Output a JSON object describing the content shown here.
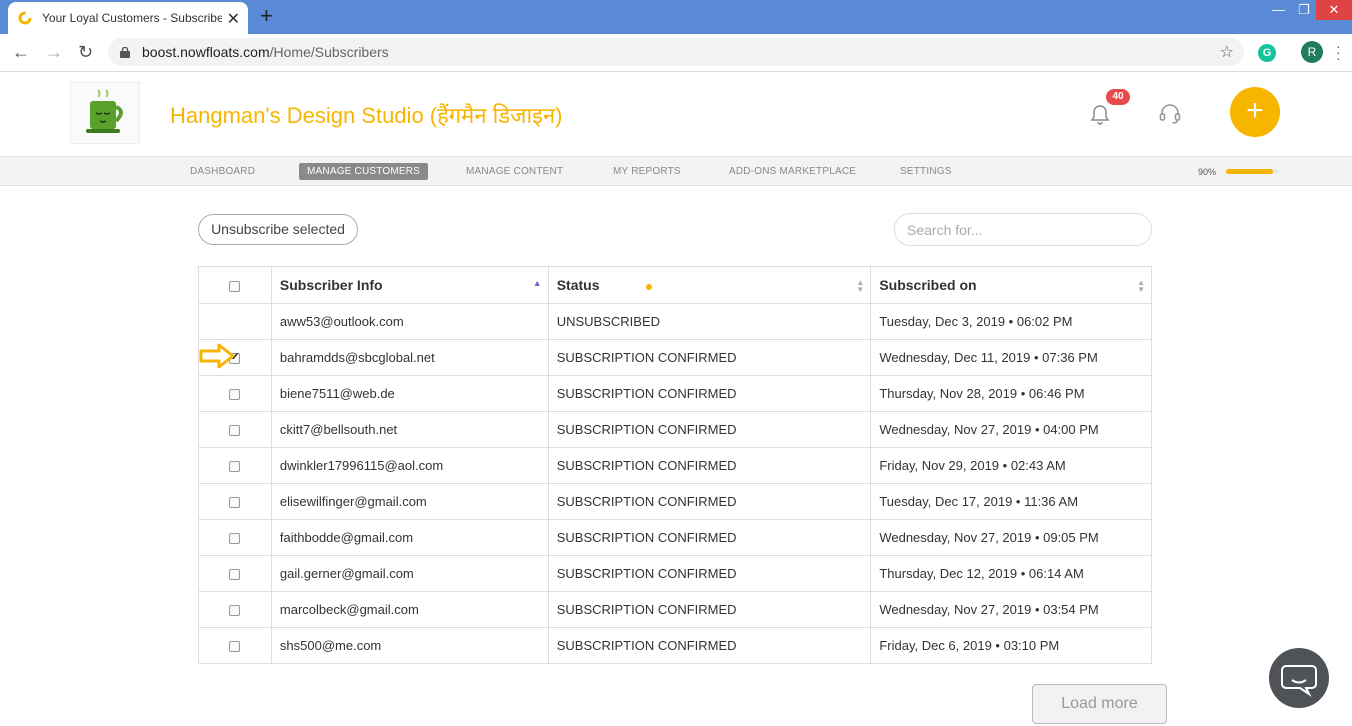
{
  "browser": {
    "tab_title": "Your Loyal Customers - Subscribers",
    "url_host": "boost.nowfloats.com",
    "url_path": "/Home/Subscribers",
    "profile_initial": "R",
    "extension_initial": "G"
  },
  "header": {
    "brand": "Hangman's Design Studio (हैंगमैन डिजाइन)",
    "notification_count": "40",
    "add_label": "+"
  },
  "nav": {
    "items": [
      "DASHBOARD",
      "MANAGE CUSTOMERS",
      "MANAGE CONTENT",
      "MY REPORTS",
      "ADD-ONS MARKETPLACE",
      "SETTINGS"
    ],
    "active": "MANAGE CUSTOMERS",
    "progress_label": "90%",
    "progress_value": 90
  },
  "toolbar": {
    "unsubscribe_label": "Unsubscribe selected",
    "search_placeholder": "Search for..."
  },
  "table": {
    "headers": [
      "Subscriber Info",
      "Status",
      "Subscribed on"
    ],
    "rows": [
      {
        "email": "aww53@outlook.com",
        "status": "UNSUBSCRIBED",
        "date": "Tuesday, Dec 3, 2019 • 06:02 PM",
        "checkbox": false,
        "checked": false
      },
      {
        "email": "bahramdds@sbcglobal.net",
        "status": "SUBSCRIPTION CONFIRMED",
        "date": "Wednesday, Dec 11, 2019 • 07:36 PM",
        "checkbox": true,
        "checked": true
      },
      {
        "email": "biene7511@web.de",
        "status": "SUBSCRIPTION CONFIRMED",
        "date": "Thursday, Nov 28, 2019 • 06:46 PM",
        "checkbox": true,
        "checked": false
      },
      {
        "email": "ckitt7@bellsouth.net",
        "status": "SUBSCRIPTION CONFIRMED",
        "date": "Wednesday, Nov 27, 2019 • 04:00 PM",
        "checkbox": true,
        "checked": false
      },
      {
        "email": "dwinkler17996115@aol.com",
        "status": "SUBSCRIPTION CONFIRMED",
        "date": "Friday, Nov 29, 2019 • 02:43 AM",
        "checkbox": true,
        "checked": false
      },
      {
        "email": "elisewilfinger@gmail.com",
        "status": "SUBSCRIPTION CONFIRMED",
        "date": "Tuesday, Dec 17, 2019 • 11:36 AM",
        "checkbox": true,
        "checked": false
      },
      {
        "email": "faithbodde@gmail.com",
        "status": "SUBSCRIPTION CONFIRMED",
        "date": "Wednesday, Nov 27, 2019 • 09:05 PM",
        "checkbox": true,
        "checked": false
      },
      {
        "email": "gail.gerner@gmail.com",
        "status": "SUBSCRIPTION CONFIRMED",
        "date": "Thursday, Dec 12, 2019 • 06:14 AM",
        "checkbox": true,
        "checked": false
      },
      {
        "email": "marcolbeck@gmail.com",
        "status": "SUBSCRIPTION CONFIRMED",
        "date": "Wednesday, Nov 27, 2019 • 03:54 PM",
        "checkbox": true,
        "checked": false
      },
      {
        "email": "shs500@me.com",
        "status": "SUBSCRIPTION CONFIRMED",
        "date": "Friday, Dec 6, 2019 • 03:10 PM",
        "checkbox": true,
        "checked": false
      }
    ]
  },
  "footer": {
    "load_more_label": "Load more"
  },
  "colors": {
    "accent": "#f7b500",
    "chrome_tab_bar": "#5b8bd6",
    "badge": "#e84b4b",
    "chat": "#4f5357"
  }
}
